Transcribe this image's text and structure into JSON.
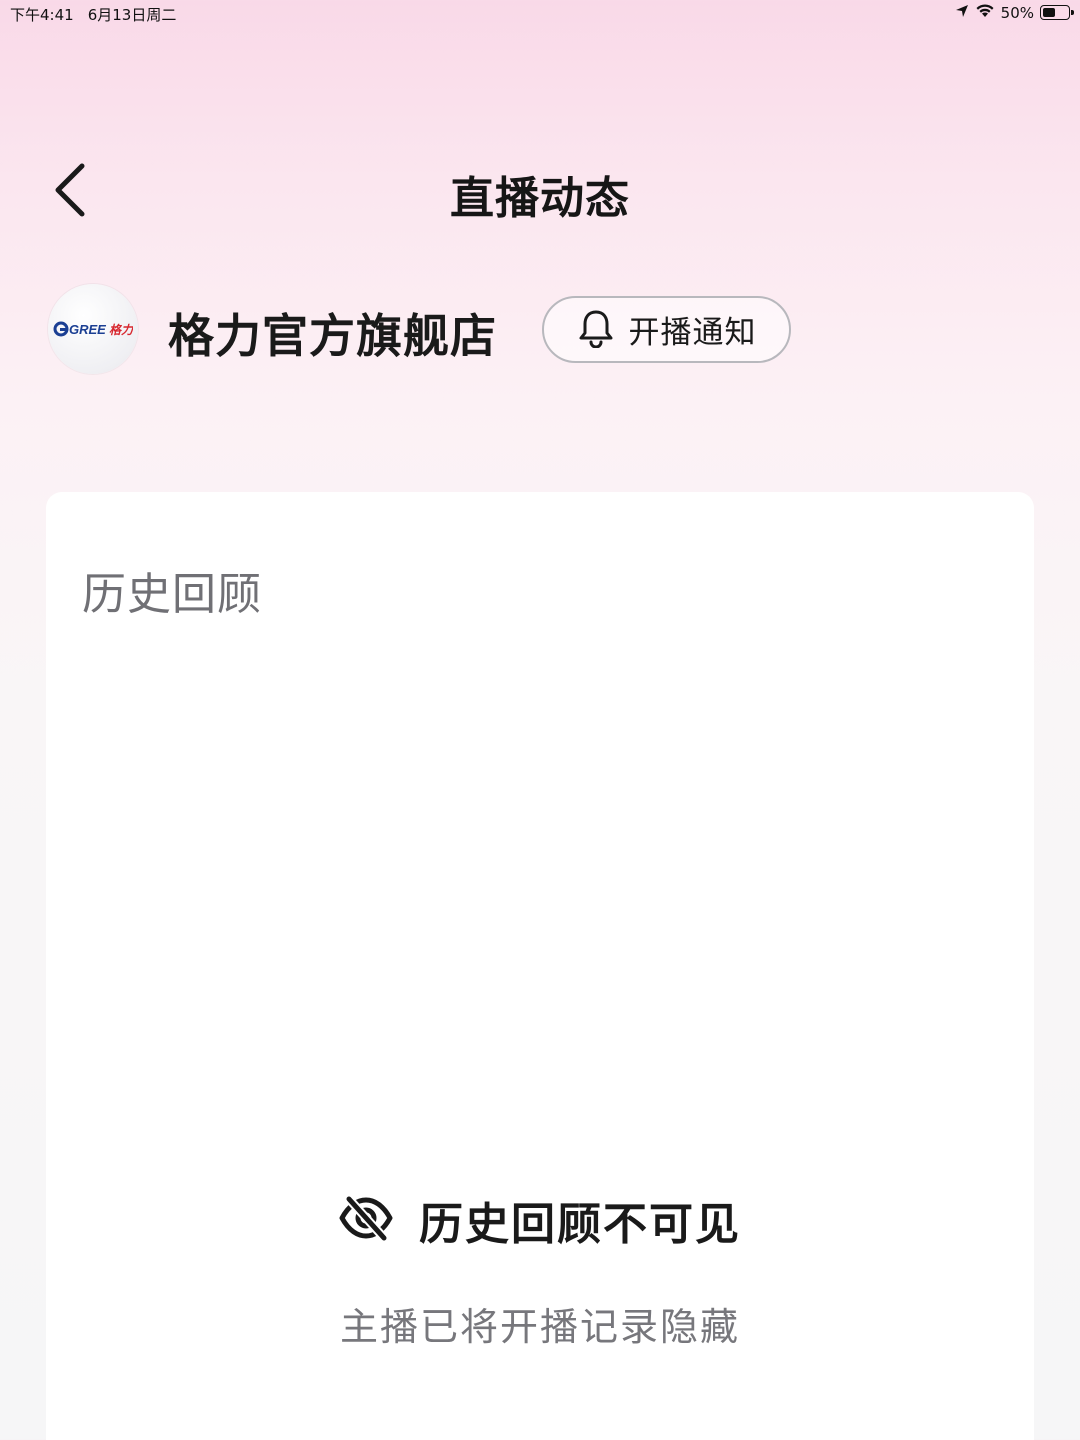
{
  "status_bar": {
    "time": "下午4:41",
    "date": "6月13日周二",
    "battery": "50%",
    "battery_level": 0.5
  },
  "header": {
    "title": "直播动态",
    "back_icon": "chevron-left-icon"
  },
  "shop": {
    "name": "格力官方旗舰店",
    "logo_text": "GREE格力",
    "notify_label": "开播通知",
    "notify_icon": "bell-icon"
  },
  "history": {
    "section_title": "历史回顾",
    "empty_title": "历史回顾不可见",
    "empty_subtitle": "主播已将开播记录隐藏",
    "empty_icon": "eye-off-icon"
  },
  "colors": {
    "logo_blue": "#1b3f93",
    "logo_red": "#d7282f"
  }
}
